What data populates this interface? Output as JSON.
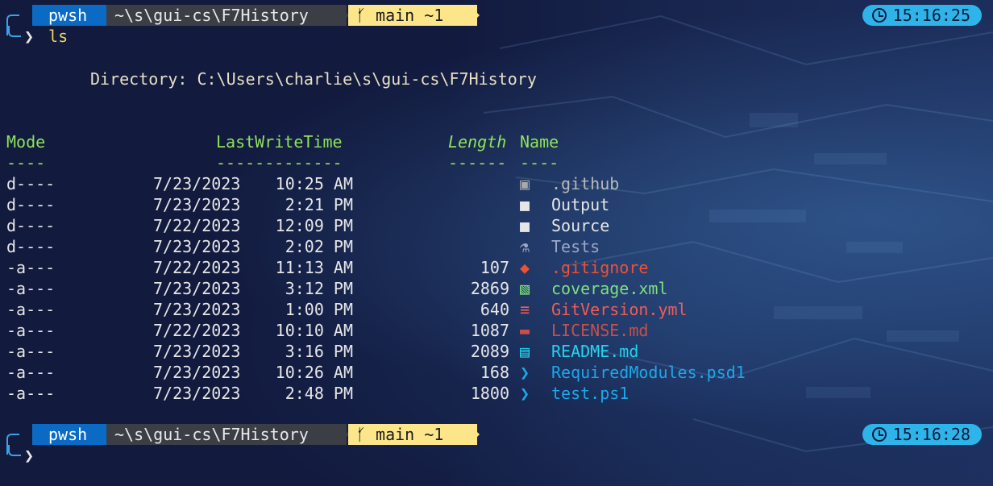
{
  "prompt1": {
    "shell": "pwsh",
    "path": "~\\s\\gui-cs\\F7History",
    "git": "main ~1",
    "git_icon": "branch-icon",
    "time": "15:16:25",
    "command": "ls"
  },
  "directory_label": "Directory: C:\\Users\\charlie\\s\\gui-cs\\F7History",
  "headers": {
    "mode": "Mode",
    "lastwritetime": "LastWriteTime",
    "length": "Length",
    "name": "Name",
    "mode_rule": "----",
    "lwt_rule": "-------------",
    "len_rule": "------",
    "name_rule": "----"
  },
  "rows": [
    {
      "mode": "d----",
      "date": "7/23/2023",
      "time": "10:25 AM",
      "length": "",
      "name": ".github",
      "icon": "github-folder-icon",
      "color": "#b8b8b8"
    },
    {
      "mode": "d----",
      "date": "7/23/2023",
      "time": "2:21 PM",
      "length": "",
      "name": "Output",
      "icon": "folder-icon",
      "color": "#e6e6e6"
    },
    {
      "mode": "d----",
      "date": "7/22/2023",
      "time": "12:09 PM",
      "length": "",
      "name": "Source",
      "icon": "folder-icon",
      "color": "#e6e6e6"
    },
    {
      "mode": "d----",
      "date": "7/23/2023",
      "time": "2:02 PM",
      "length": "",
      "name": "Tests",
      "icon": "flask-icon",
      "color": "#9aa7c9"
    },
    {
      "mode": "-a---",
      "date": "7/22/2023",
      "time": "11:13 AM",
      "length": "107",
      "name": ".gitignore",
      "icon": "git-icon",
      "color": "#f05133"
    },
    {
      "mode": "-a---",
      "date": "7/23/2023",
      "time": "3:12 PM",
      "length": "2869",
      "name": "coverage.xml",
      "icon": "xml-file-icon",
      "color": "#7ee07e"
    },
    {
      "mode": "-a---",
      "date": "7/23/2023",
      "time": "1:00 PM",
      "length": "640",
      "name": "GitVersion.yml",
      "icon": "yaml-file-icon",
      "color": "#f25c54"
    },
    {
      "mode": "-a---",
      "date": "7/22/2023",
      "time": "10:10 AM",
      "length": "1087",
      "name": "LICENSE.md",
      "icon": "markdown-icon",
      "color": "#c8504a"
    },
    {
      "mode": "-a---",
      "date": "7/23/2023",
      "time": "3:16 PM",
      "length": "2089",
      "name": "README.md",
      "icon": "readme-icon",
      "color": "#22d3ee"
    },
    {
      "mode": "-a---",
      "date": "7/23/2023",
      "time": "10:26 AM",
      "length": "168",
      "name": "RequiredModules.psd1",
      "icon": "powershell-icon",
      "color": "#1ea7e8"
    },
    {
      "mode": "-a---",
      "date": "7/23/2023",
      "time": "2:48 PM",
      "length": "1800",
      "name": "test.ps1",
      "icon": "powershell-icon",
      "color": "#1ea7e8"
    }
  ],
  "prompt2": {
    "shell": "pwsh",
    "path": "~\\s\\gui-cs\\F7History",
    "git": "main ~1",
    "git_icon": "branch-icon",
    "time": "15:16:28"
  },
  "colors": {
    "background": "#10173a",
    "pwsh_segment": "#0b6bc4",
    "path_segment": "#3b3f45",
    "git_segment": "#fde68a",
    "time_pill": "#2fb4ea",
    "header": "#8ee35a",
    "command": "#f2d35b"
  }
}
